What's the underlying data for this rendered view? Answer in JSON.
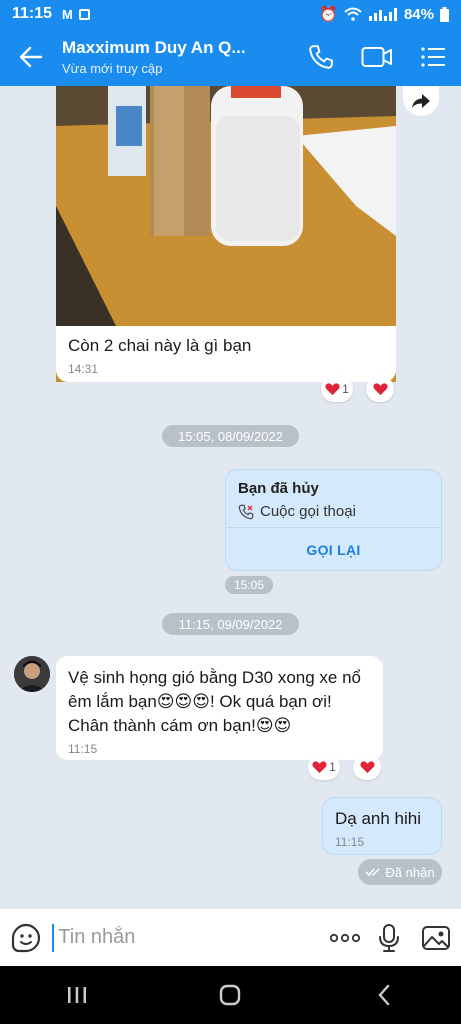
{
  "status_bar": {
    "time": "11:15",
    "battery": "84%"
  },
  "header": {
    "title": "Maxximum Duy An Q...",
    "subtitle": "Vừa mới truy cập",
    "color": "#1a8cf0"
  },
  "messages": {
    "image_caption": "Còn 2 chai này là gì bạn",
    "image_time": "14:31",
    "image_reaction_count": "1",
    "date_1": "15:05, 08/09/2022",
    "call_title": "Bạn đã hủy",
    "call_subtitle": "Cuộc gọi thoại",
    "call_action": "GỌI LẠI",
    "call_time": "15:05",
    "date_2": "11:15, 09/09/2022",
    "incoming_text": "Vệ sinh họng gió bằng D30 xong xe nổ êm lắm bạn😍😍😍! Ok quá bạn ơi! Chân thành cám ơn bạn!😍😍",
    "incoming_time": "11:15",
    "incoming_reaction_count": "1",
    "outgoing_text": "Dạ anh hihi",
    "outgoing_time": "11:15",
    "delivery_status": "Đã nhận"
  },
  "input": {
    "placeholder": "Tin nhắn"
  },
  "icons": {
    "back": "arrow-left-icon",
    "phone": "phone-icon",
    "video": "video-camera-icon",
    "menu": "list-menu-icon",
    "share": "share-forward-icon",
    "heart": "heart-icon",
    "sticker": "sticker-face-icon",
    "more": "more-dots-icon",
    "mic": "microphone-icon",
    "gallery": "image-gallery-icon"
  }
}
